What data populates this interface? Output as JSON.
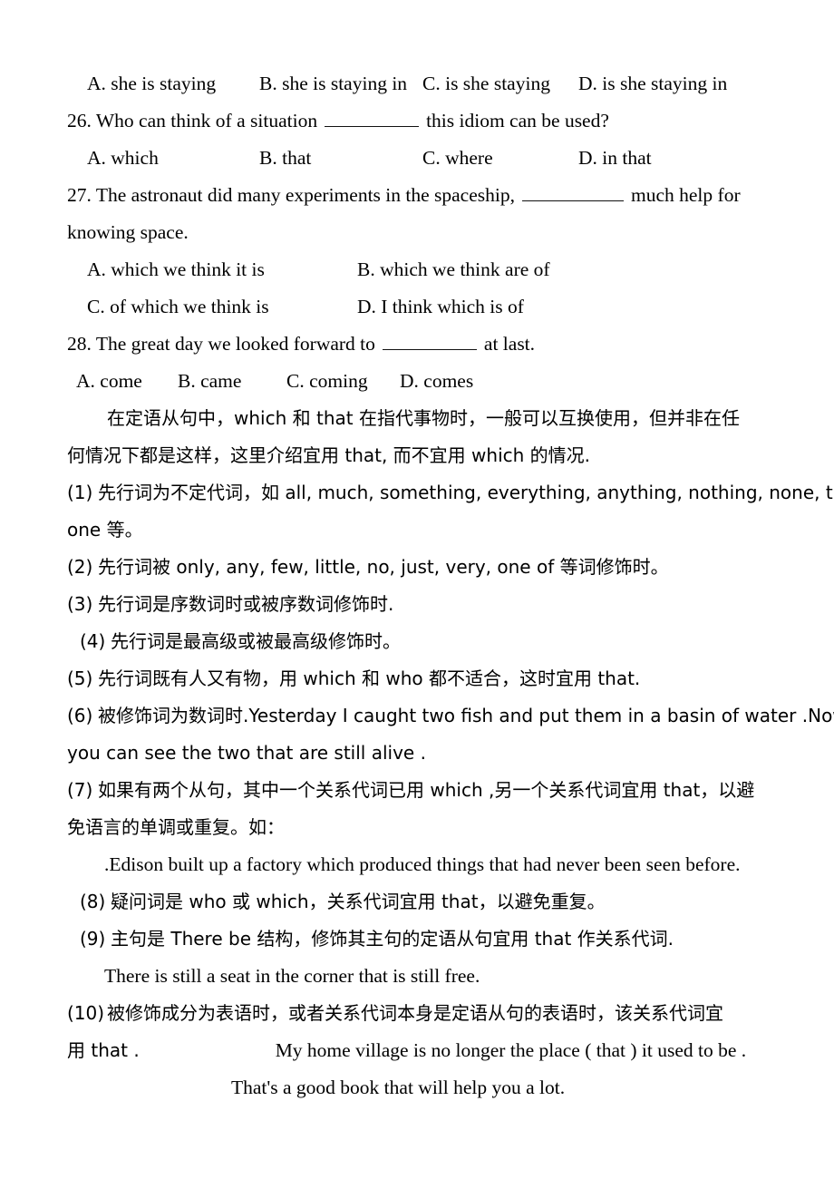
{
  "page": {
    "background": "#ffffff",
    "text_color": "#000000"
  },
  "q25_options": {
    "a": "A. she is staying",
    "b": "B. she is staying in",
    "c": "C. is she staying",
    "d": "D. is she staying in"
  },
  "q26": {
    "stem_before": "26. Who can think of a situation",
    "stem_after": "this idiom can be used?",
    "options": {
      "a": "A. which",
      "b": "B. that",
      "c": "C. where",
      "d": "D. in that"
    }
  },
  "q27": {
    "stem_before": "27. The astronaut did many experiments in the spaceship,",
    "stem_after": "much help for",
    "stem_line2": "knowing space.",
    "options": {
      "a": "A. which we think it is",
      "b": "B. which we think are of",
      "c": "C. of which we think is",
      "d": "D. I think which is of"
    }
  },
  "q28": {
    "stem_before": "28. The great day we looked forward to",
    "stem_after": "at last.",
    "options": {
      "a": "A. come",
      "b": "B. came",
      "c": "C. coming",
      "d": "D. comes"
    }
  },
  "intro": {
    "line1": "在定语从句中，which 和 that 在指代事物时，一般可以互换使用，但并非在任",
    "line2": "何情况下都是这样，这里介绍宜用 that, 而不宜用 which 的情况."
  },
  "rules": [
    {
      "number": "(1)",
      "line1": "先行词为不定代词，如 all, much, something, everything, anything, nothing, none, the",
      "line2": "one 等。"
    },
    {
      "number": "(2)",
      "line1": "先行词被 only, any, few, little, no, just, very, one of 等词修饰时。"
    },
    {
      "number": "(3)",
      "line1": "先行词是序数词时或被序数词修饰时."
    },
    {
      "number": "(4)",
      "line1": "先行词是最高级或被最高级修饰时。"
    },
    {
      "number": "(5)",
      "line1": "先行词既有人又有物，用 which 和 who 都不适合，这时宜用 that."
    },
    {
      "number": "(6)",
      "line1": "被修饰词为数词时.Yesterday I caught two fish and put them in a basin of water .Now",
      "line2": "you can see the two that are still alive ."
    },
    {
      "number": "(7)",
      "line1": "如果有两个从句，其中一个关系代词已用 which ,另一个关系代词宜用 that，以避",
      "line2": "免语言的单调或重复。如：",
      "example": ".Edison built up a factory which produced things that had never been seen before."
    },
    {
      "number": "(8)",
      "line1": "疑问词是 who 或 which，关系代词宜用 that，以避免重复。"
    },
    {
      "number": "(9)",
      "line1": "主句是 There be 结构，修饰其主句的定语从句宜用 that 作关系代词.",
      "example": "There is still a seat in the corner that is still free."
    },
    {
      "number": "(10)",
      "line1": "被修饰成分为表语时，或者关系代词本身是定语从句的表语时，该关系代词宜",
      "line2_prefix": "用 that .",
      "line2_example": "My home village is no longer the place ( that ) it used to be .",
      "example2": "That's a good book that will help you a lot."
    }
  ]
}
